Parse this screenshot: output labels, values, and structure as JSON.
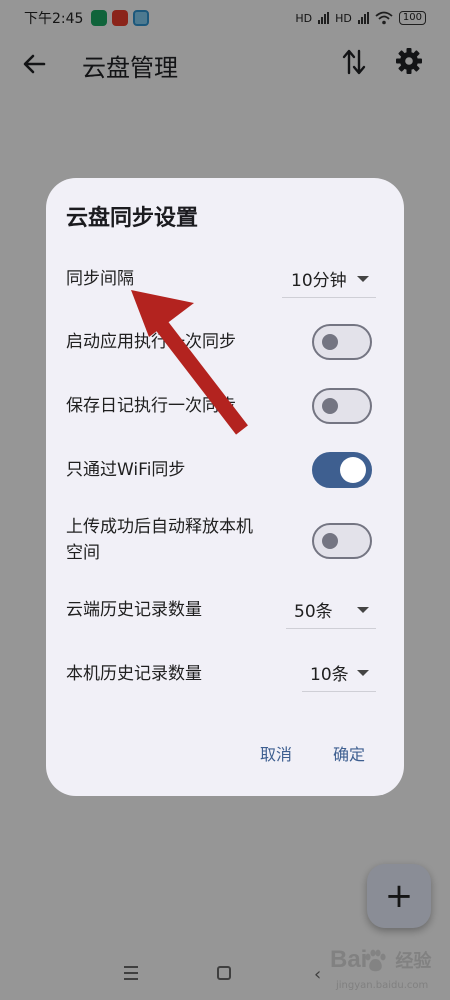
{
  "status_bar": {
    "time": "下午2:45",
    "signal_1": "HD",
    "signal_2": "HD",
    "battery": "100"
  },
  "app_bar": {
    "title": "云盘管理",
    "back_icon": "arrow-back-icon",
    "sort_icon": "swap-vertical-icon",
    "settings_icon": "gear-icon"
  },
  "dialog": {
    "title": "云盘同步设置",
    "sync_interval": {
      "label": "同步间隔",
      "value": "10分钟"
    },
    "sync_on_launch": {
      "label": "启动应用执行一次同步",
      "on": false
    },
    "sync_on_save": {
      "label": "保存日记执行一次同步",
      "on": false
    },
    "wifi_only": {
      "label": "只通过WiFi同步",
      "on": true
    },
    "free_space": {
      "label_line1": "上传成功后自动释放本机",
      "label_line2": "空间",
      "on": false
    },
    "cloud_history": {
      "label": "云端历史记录数量",
      "value": "50条"
    },
    "local_history": {
      "label": "本机历史记录数量",
      "value": "10条"
    },
    "cancel_label": "取消",
    "confirm_label": "确定"
  },
  "fab": {
    "label": "+"
  },
  "watermark": {
    "brand_left": "Bai",
    "brand_right": "经验",
    "url": "jingyan.baidu.com"
  },
  "colors": {
    "accent": "#3e5f90",
    "dialog_bg": "#f1f0f7",
    "annotation_arrow": "#b3231f"
  }
}
